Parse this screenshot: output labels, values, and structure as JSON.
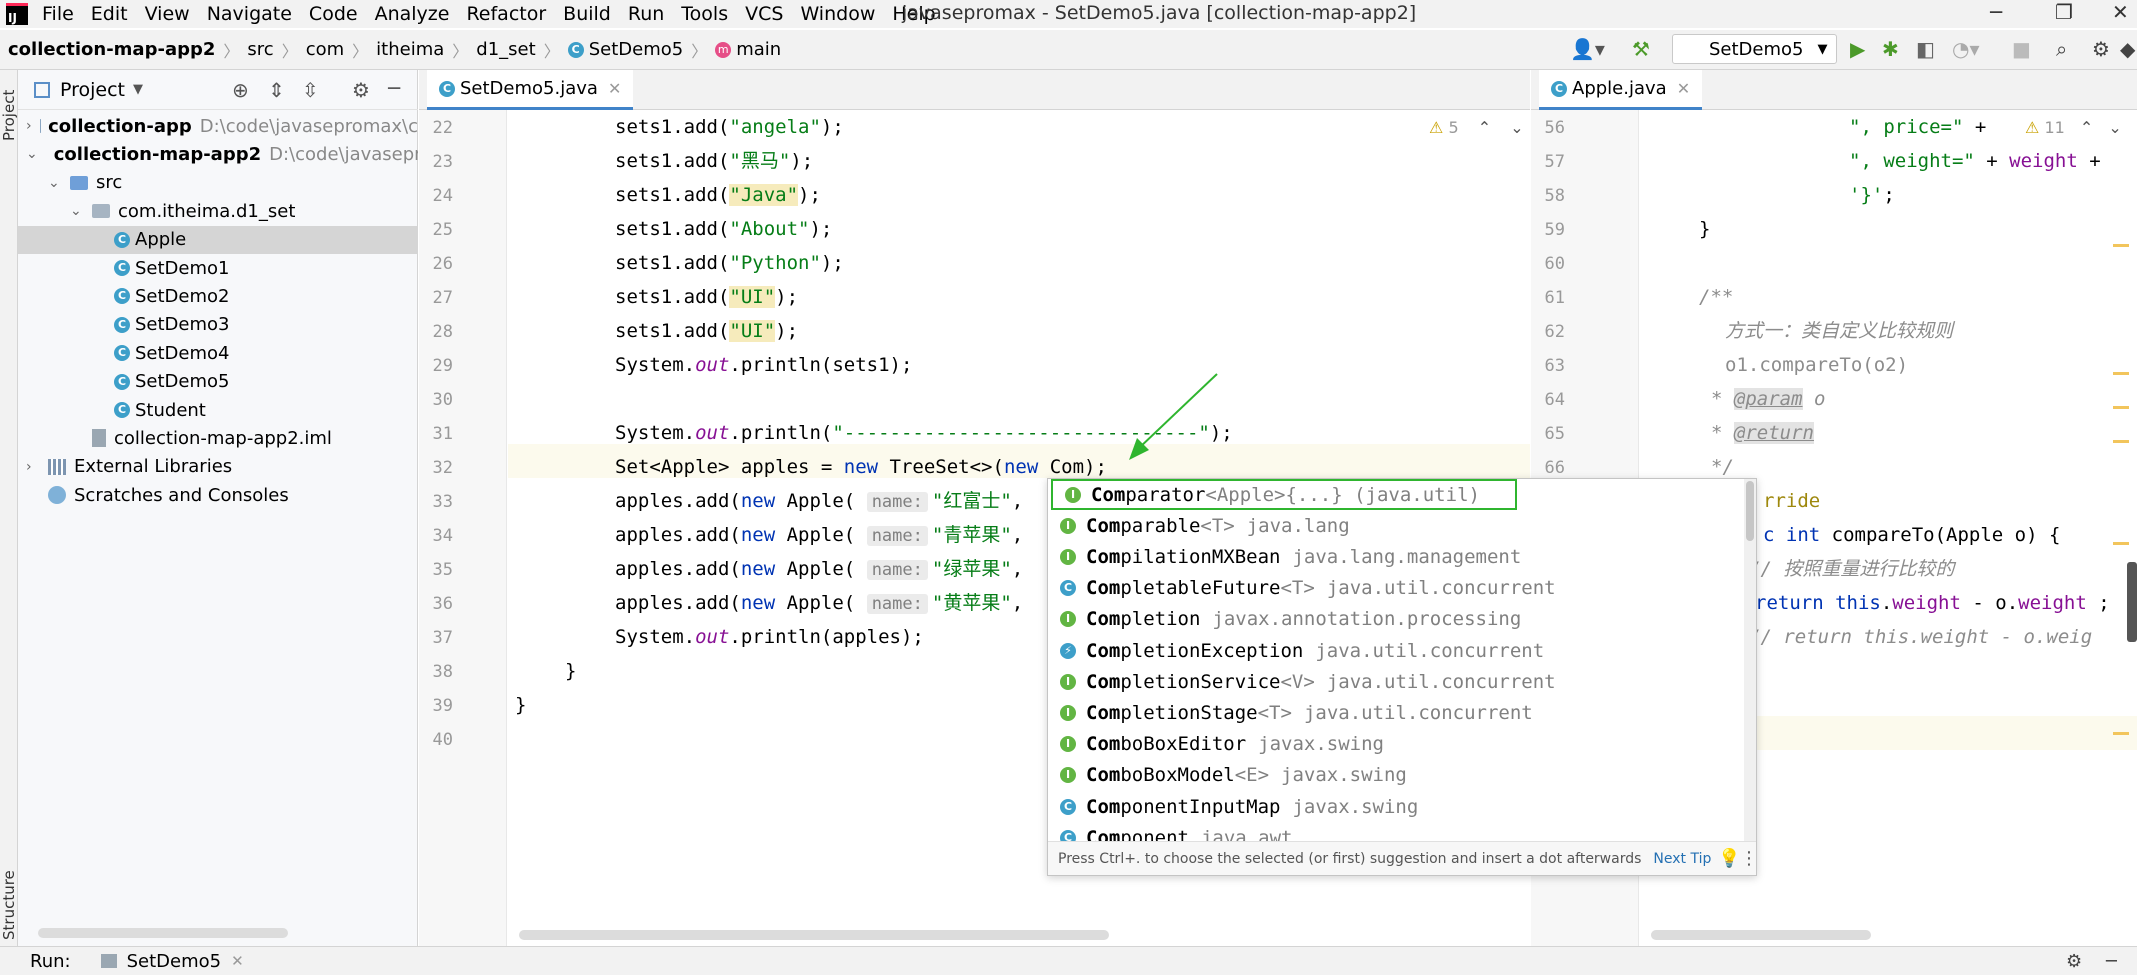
{
  "menubar": {
    "items": [
      "File",
      "Edit",
      "View",
      "Navigate",
      "Code",
      "Analyze",
      "Refactor",
      "Build",
      "Run",
      "Tools",
      "VCS",
      "Window",
      "Help"
    ],
    "window_title": "javasepromax - SetDemo5.java [collection-map-app2]"
  },
  "breadcrumb": {
    "project": "collection-map-app2",
    "items": [
      "src",
      "com",
      "itheima",
      "d1_set",
      "SetDemo5",
      "main"
    ]
  },
  "toolbar": {
    "run_config": "SetDemo5"
  },
  "project_panel": {
    "title": "Project",
    "tree": [
      {
        "label": "collection-app",
        "path": "D:\\code\\javasepromax\\c",
        "bold": true,
        "arrow": "right",
        "icon": "module-folder-icon",
        "indent": 0
      },
      {
        "label": "collection-map-app2",
        "path": "D:\\code\\javasepro",
        "bold": true,
        "arrow": "down",
        "icon": "module-folder-icon",
        "indent": 0
      },
      {
        "label": "src",
        "path": "",
        "bold": false,
        "arrow": "down",
        "icon": "source-folder-icon",
        "indent": 1
      },
      {
        "label": "com.itheima.d1_set",
        "path": "",
        "bold": false,
        "arrow": "down",
        "icon": "package-icon",
        "indent": 2
      },
      {
        "label": "Apple",
        "path": "",
        "bold": false,
        "arrow": "",
        "icon": "class-icon",
        "indent": 3,
        "selected": true
      },
      {
        "label": "SetDemo1",
        "path": "",
        "bold": false,
        "arrow": "",
        "icon": "runnable-class-icon",
        "indent": 3
      },
      {
        "label": "SetDemo2",
        "path": "",
        "bold": false,
        "arrow": "",
        "icon": "runnable-class-icon",
        "indent": 3
      },
      {
        "label": "SetDemo3",
        "path": "",
        "bold": false,
        "arrow": "",
        "icon": "runnable-class-icon",
        "indent": 3
      },
      {
        "label": "SetDemo4",
        "path": "",
        "bold": false,
        "arrow": "",
        "icon": "runnable-class-icon",
        "indent": 3
      },
      {
        "label": "SetDemo5",
        "path": "",
        "bold": false,
        "arrow": "",
        "icon": "runnable-class-icon",
        "indent": 3
      },
      {
        "label": "Student",
        "path": "",
        "bold": false,
        "arrow": "",
        "icon": "class-icon",
        "indent": 3
      },
      {
        "label": "collection-map-app2.iml",
        "path": "",
        "bold": false,
        "arrow": "",
        "icon": "iml-file-icon",
        "indent": 2
      },
      {
        "label": "External Libraries",
        "path": "",
        "bold": false,
        "arrow": "right",
        "icon": "library-icon",
        "indent": 0
      },
      {
        "label": "Scratches and Consoles",
        "path": "",
        "bold": false,
        "arrow": "",
        "icon": "scratches-icon",
        "indent": 0
      }
    ]
  },
  "left_strip": {
    "project_label": "Project",
    "structure_label": "Structure"
  },
  "editor_left": {
    "tab": "SetDemo5.java",
    "warning_count": "5",
    "line_numbers": [
      "22",
      "23",
      "24",
      "25",
      "26",
      "27",
      "28",
      "29",
      "30",
      "31",
      "32",
      "33",
      "34",
      "35",
      "36",
      "37",
      "38",
      "39",
      "40"
    ]
  },
  "editor_right": {
    "tab": "Apple.java",
    "warning_count": "11",
    "line_numbers": [
      "56",
      "57",
      "58",
      "59",
      "60",
      "61",
      "62",
      "63",
      "64",
      "65",
      "66"
    ]
  },
  "completion": {
    "items": [
      {
        "icon": "I",
        "match": "Com",
        "rest": "parator",
        "type": "<Apple>{...} (java.util)",
        "pkg": ""
      },
      {
        "icon": "I",
        "match": "Com",
        "rest": "parable",
        "type": "<T>",
        "pkg": "java.lang"
      },
      {
        "icon": "I",
        "match": "Com",
        "rest": "pilationMXBean",
        "type": "",
        "pkg": "java.lang.management"
      },
      {
        "icon": "C",
        "match": "Com",
        "rest": "pletableFuture",
        "type": "<T>",
        "pkg": "java.util.concurrent"
      },
      {
        "icon": "I",
        "match": "Com",
        "rest": "pletion",
        "type": "",
        "pkg": "javax.annotation.processing"
      },
      {
        "icon": "E",
        "match": "Com",
        "rest": "pletionException",
        "type": "",
        "pkg": "java.util.concurrent"
      },
      {
        "icon": "I",
        "match": "Com",
        "rest": "pletionService",
        "type": "<V>",
        "pkg": "java.util.concurrent"
      },
      {
        "icon": "I",
        "match": "Com",
        "rest": "pletionStage",
        "type": "<T>",
        "pkg": "java.util.concurrent"
      },
      {
        "icon": "I",
        "match": "Com",
        "rest": "boBoxEditor",
        "type": "",
        "pkg": "javax.swing"
      },
      {
        "icon": "I",
        "match": "Com",
        "rest": "boBoxModel",
        "type": "<E>",
        "pkg": "javax.swing"
      },
      {
        "icon": "C",
        "match": "Com",
        "rest": "ponentInputMap",
        "type": "",
        "pkg": "javax.swing"
      },
      {
        "icon": "C",
        "match": "Com",
        "rest": "ponent",
        "type": "",
        "pkg": "java.awt"
      }
    ],
    "footer": "Press Ctrl+. to choose the selected (or first) suggestion and insert a dot afterwards",
    "next_tip": "Next Tip"
  },
  "runbar": {
    "label": "Run:",
    "config": "SetDemo5"
  }
}
